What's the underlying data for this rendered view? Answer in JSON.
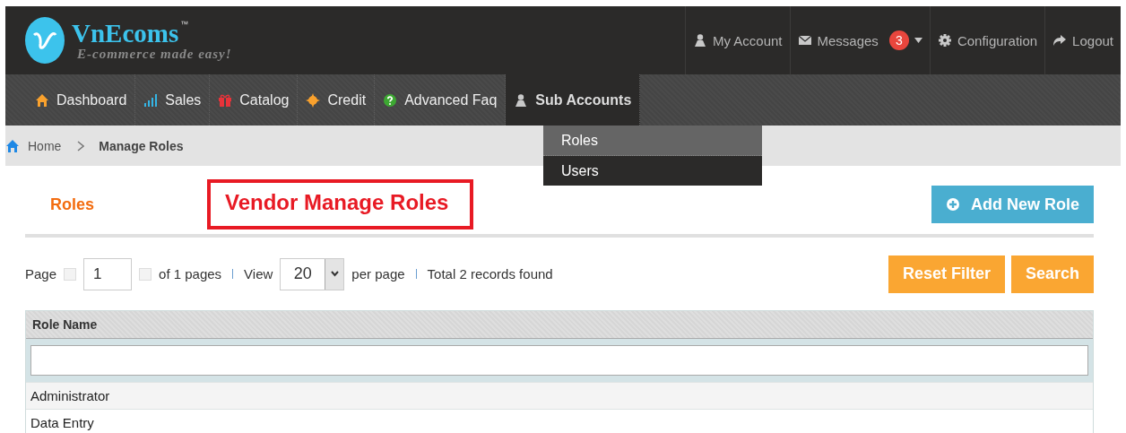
{
  "header": {
    "logo": {
      "name": "VnEcoms",
      "tm": "™",
      "tagline": "E-commerce made easy!"
    },
    "links": [
      {
        "label": "My Account"
      },
      {
        "label": "Messages",
        "badge": "3",
        "dropdown": true
      },
      {
        "label": "Configuration"
      },
      {
        "label": "Logout"
      }
    ]
  },
  "nav": [
    {
      "label": "Dashboard",
      "selected": false
    },
    {
      "label": "Sales",
      "selected": false
    },
    {
      "label": "Catalog",
      "selected": false
    },
    {
      "label": "Credit",
      "selected": false
    },
    {
      "label": "Advanced Faq",
      "selected": false
    },
    {
      "label": "Sub Accounts",
      "selected": true
    }
  ],
  "submenu": [
    {
      "label": "Roles",
      "selected": true
    },
    {
      "label": "Users",
      "selected": false
    }
  ],
  "breadcrumb": [
    "Home",
    "Manage Roles"
  ],
  "section_tab": "Roles",
  "title": {
    "text": "Vendor Manage Roles",
    "highlighted": true
  },
  "add_button": "Add New Role",
  "pager": {
    "page_label": "Page",
    "page": "1",
    "of_pages": "of 1 pages",
    "view_label": "View",
    "per_page": "20",
    "per_page_label": "per page",
    "total": "Total 2 records found"
  },
  "buttons": [
    "Reset Filter",
    "Search"
  ],
  "table": {
    "columns": [
      "Role Name"
    ],
    "rows": [
      [
        "Administrator"
      ],
      [
        "Data Entry"
      ]
    ]
  }
}
